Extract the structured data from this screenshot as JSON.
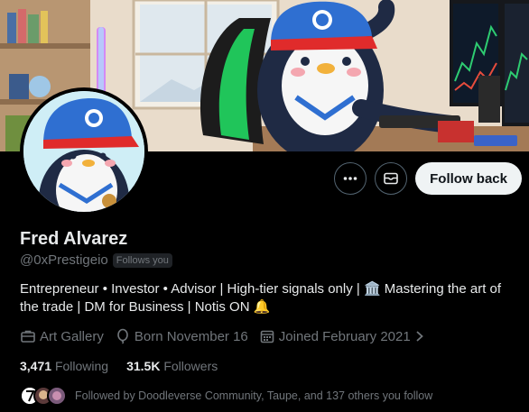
{
  "profile": {
    "name": "Fred Alvarez",
    "handle": "@0xPrestigeio",
    "follows_you": "Follows you",
    "bio": "Entrepreneur • Investor • Advisor | High-tier signals only | 🏛️ Mastering the art of the trade | DM for Business | Notis ON 🔔",
    "location": "Art Gallery",
    "born": "Born November 16",
    "joined": "Joined February 2021",
    "following_count": "3,471",
    "following_label": "Following",
    "followers_count": "31.5K",
    "followers_label": "Followers",
    "followed_by": "Followed by Doodleverse Community, Taupe, and 137 others you follow"
  },
  "actions": {
    "follow_back_label": "Follow back",
    "more_icon": "more-icon",
    "message_icon": "mail-icon"
  },
  "colors": {
    "background": "#000000",
    "muted_text": "#71767b",
    "primary_text": "#e7e9ea",
    "button_bg": "#eff3f4"
  }
}
